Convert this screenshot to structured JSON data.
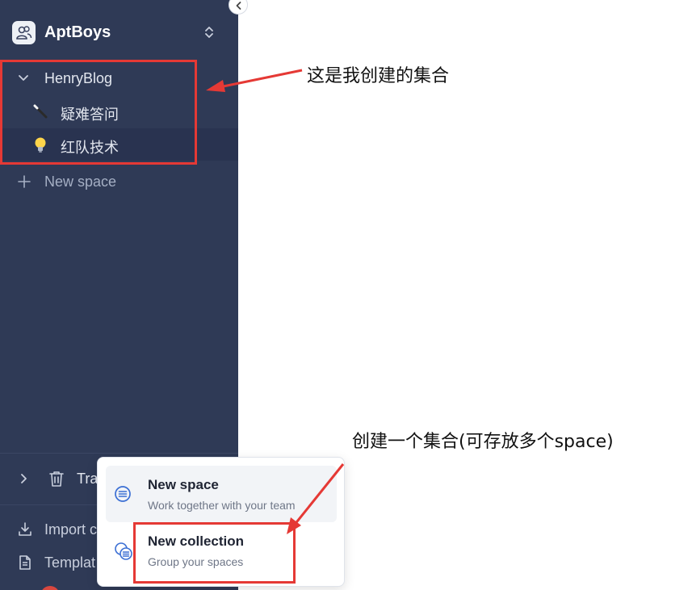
{
  "workspace": {
    "name": "AptBoys"
  },
  "sidebar": {
    "collection": {
      "label": "HenryBlog"
    },
    "spaces": [
      {
        "label": "疑难答问",
        "icon": "wand-icon"
      },
      {
        "label": "红队技术",
        "icon": "light-bulb-icon"
      }
    ],
    "new_space_label": "New space",
    "trash_label": "Tra",
    "import_label": "Import c",
    "templates_label": "Templat"
  },
  "popup": {
    "items": [
      {
        "title": "New space",
        "description": "Work together with your team",
        "icon": "space-icon"
      },
      {
        "title": "New collection",
        "description": "Group your spaces",
        "icon": "collection-icon"
      }
    ]
  },
  "annotations": {
    "collection_note": "这是我创建的集合",
    "create_note": "创建一个集合(可存放多个space)"
  },
  "colors": {
    "sidebar_bg": "#2f3a56",
    "annotation_red": "#e53935",
    "accent_blue": "#3b6fd4"
  }
}
